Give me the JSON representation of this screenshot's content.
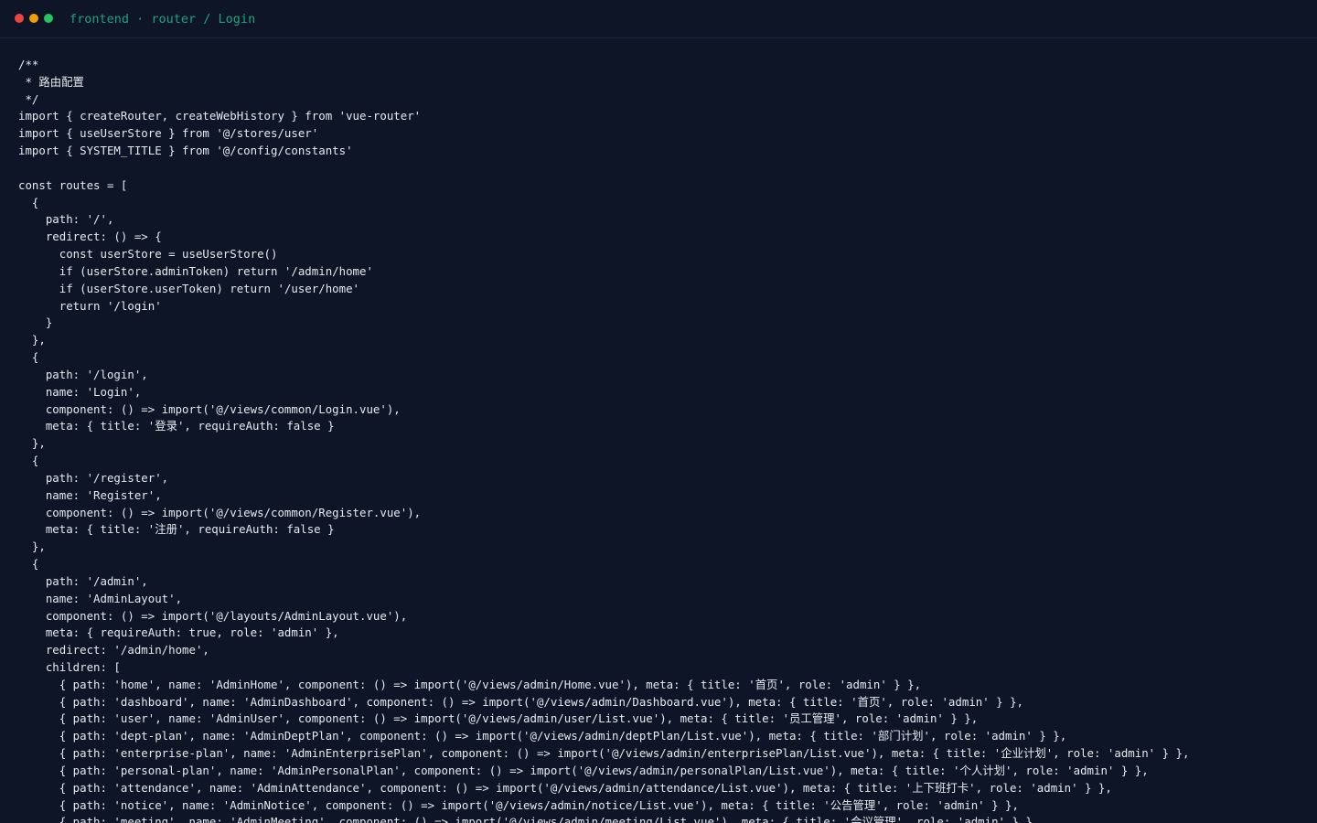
{
  "window": {
    "title": "frontend · router / Login",
    "controls": {
      "close_color": "#ef4444",
      "minimize_color": "#f59e0b",
      "maximize_color": "#22c55e"
    }
  },
  "editor": {
    "language": "javascript",
    "lines": [
      "/**",
      " * 路由配置",
      " */",
      "import { createRouter, createWebHistory } from 'vue-router'",
      "import { useUserStore } from '@/stores/user'",
      "import { SYSTEM_TITLE } from '@/config/constants'",
      "",
      "const routes = [",
      "  {",
      "    path: '/',",
      "    redirect: () => {",
      "      const userStore = useUserStore()",
      "      if (userStore.adminToken) return '/admin/home'",
      "      if (userStore.userToken) return '/user/home'",
      "      return '/login'",
      "    }",
      "  },",
      "  {",
      "    path: '/login',",
      "    name: 'Login',",
      "    component: () => import('@/views/common/Login.vue'),",
      "    meta: { title: '登录', requireAuth: false }",
      "  },",
      "  {",
      "    path: '/register',",
      "    name: 'Register',",
      "    component: () => import('@/views/common/Register.vue'),",
      "    meta: { title: '注册', requireAuth: false }",
      "  },",
      "  {",
      "    path: '/admin',",
      "    name: 'AdminLayout',",
      "    component: () => import('@/layouts/AdminLayout.vue'),",
      "    meta: { requireAuth: true, role: 'admin' },",
      "    redirect: '/admin/home',",
      "    children: [",
      "      { path: 'home', name: 'AdminHome', component: () => import('@/views/admin/Home.vue'), meta: { title: '首页', role: 'admin' } },",
      "      { path: 'dashboard', name: 'AdminDashboard', component: () => import('@/views/admin/Dashboard.vue'), meta: { title: '首页', role: 'admin' } },",
      "      { path: 'user', name: 'AdminUser', component: () => import('@/views/admin/user/List.vue'), meta: { title: '员工管理', role: 'admin' } },",
      "      { path: 'dept-plan', name: 'AdminDeptPlan', component: () => import('@/views/admin/deptPlan/List.vue'), meta: { title: '部门计划', role: 'admin' } },",
      "      { path: 'enterprise-plan', name: 'AdminEnterprisePlan', component: () => import('@/views/admin/enterprisePlan/List.vue'), meta: { title: '企业计划', role: 'admin' } },",
      "      { path: 'personal-plan', name: 'AdminPersonalPlan', component: () => import('@/views/admin/personalPlan/List.vue'), meta: { title: '个人计划', role: 'admin' } },",
      "      { path: 'attendance', name: 'AdminAttendance', component: () => import('@/views/admin/attendance/List.vue'), meta: { title: '上下班打卡', role: 'admin' } },",
      "      { path: 'notice', name: 'AdminNotice', component: () => import('@/views/admin/notice/List.vue'), meta: { title: '公告管理', role: 'admin' } },",
      "      { path: 'meeting', name: 'AdminMeeting', component: () => import('@/views/admin/meeting/List.vue'), meta: { title: '会议管理', role: 'admin' } },"
    ]
  }
}
